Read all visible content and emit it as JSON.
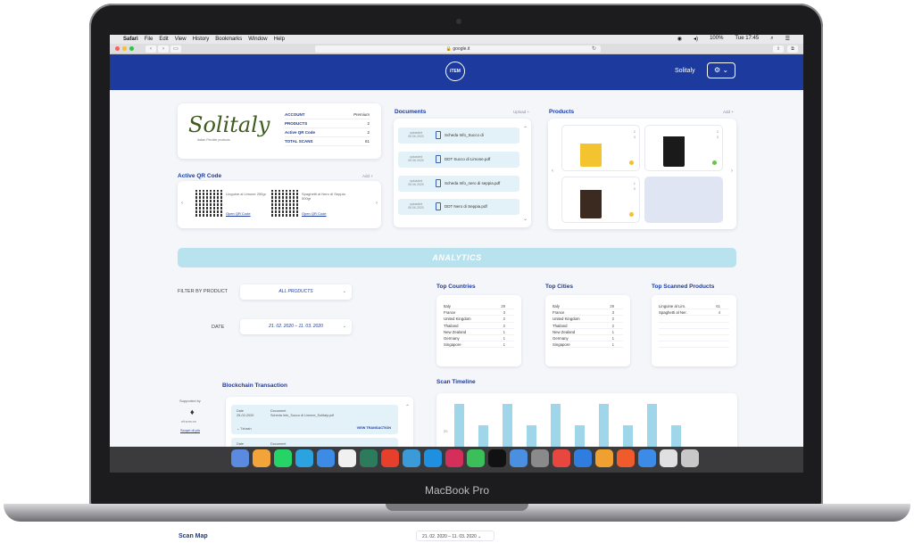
{
  "laptop": {
    "brand": "MacBook Pro"
  },
  "menubar": {
    "apple": "",
    "items": [
      "Safari",
      "File",
      "Edit",
      "View",
      "History",
      "Bookmarks",
      "Window",
      "Help"
    ],
    "battery": "100%",
    "clock": "Tue 17:45"
  },
  "safari": {
    "url": "google.it"
  },
  "app": {
    "account_name": "Solitaly",
    "logo_text": "iTEM"
  },
  "account": {
    "brand": "Solitaly",
    "tagline": "Italian Flexible products",
    "rows": [
      {
        "k": "ACCOUNT",
        "v": "Premium"
      },
      {
        "k": "PRODUCTS",
        "v": "2"
      },
      {
        "k": "Active QR Code",
        "v": "2"
      },
      {
        "k": "TOTAL SCANS",
        "v": "61"
      }
    ]
  },
  "active_qr": {
    "title": "Active QR Code",
    "add": "Add",
    "items": [
      {
        "name": "Linguine al Limone 250gr",
        "link": "Open QR Code"
      },
      {
        "name": "Spaghetti al Nero di Seppia 500gr",
        "link": "Open QR Code"
      }
    ]
  },
  "documents": {
    "title": "Documents",
    "upload": "Upload",
    "items": [
      {
        "date": "uploaded 05.06.2020",
        "name": "Scheda Info_Succo di"
      },
      {
        "date": "uploaded 05.06.2020",
        "name": "DDT Succo di Limone.pdf"
      },
      {
        "date": "uploaded 05.06.2020",
        "name": "Scheda Info_nero di seppia.pdf"
      },
      {
        "date": "uploaded 05.06.2020",
        "name": "DDT Nero di Seppia.pdf"
      }
    ]
  },
  "products": {
    "title": "Products",
    "add": "Add",
    "items": [
      {
        "s1": "2",
        "s2": "3",
        "dot": "#f2c12e"
      },
      {
        "s1": "2",
        "s2": "3",
        "dot": "#6cc24a"
      },
      {
        "s1": "1",
        "s2": "0",
        "dot": "#f2c12e"
      }
    ]
  },
  "analytics": {
    "title": "ANALYTICS"
  },
  "filters": {
    "product_label": "FILTER BY PRODUCT",
    "product_value": "ALL PRODUCTS",
    "date_label": "DATE",
    "date_value": "21. 02. 2020 – 11. 03. 2020"
  },
  "top_countries": {
    "title": "Top Countries",
    "rows": [
      {
        "name": "Italy",
        "n": "29"
      },
      {
        "name": "France",
        "n": "3"
      },
      {
        "name": "United Kingdom",
        "n": "2"
      },
      {
        "name": "Thailand",
        "n": "2"
      },
      {
        "name": "New Zealand",
        "n": "1"
      },
      {
        "name": "Germany",
        "n": "1"
      },
      {
        "name": "Singapore",
        "n": "1"
      }
    ]
  },
  "top_cities": {
    "title": "Top Cities",
    "rows": [
      {
        "name": "Italy",
        "n": "29"
      },
      {
        "name": "France",
        "n": "3"
      },
      {
        "name": "United Kingdom",
        "n": "2"
      },
      {
        "name": "Thailand",
        "n": "2"
      },
      {
        "name": "New Zealand",
        "n": "1"
      },
      {
        "name": "Germany",
        "n": "1"
      },
      {
        "name": "Singapore",
        "n": "1"
      }
    ]
  },
  "top_products": {
    "title": "Top Scanned Products",
    "rows": [
      {
        "name": "Linguine al Lim.",
        "n": "61"
      },
      {
        "name": "Spaghetti al Ner.",
        "n": "4"
      }
    ]
  },
  "blockchain": {
    "title": "Blockchain Transaction",
    "supported_by": "Supported by",
    "provider": "ethereum",
    "provider_link": "Scopri di più",
    "rows": [
      {
        "date_label": "Date",
        "date": "25-02-2020",
        "doc_label": "Document",
        "doc": "Scheda Info_Succo di Limone_Solitaly.pdf",
        "chain": "Txhash",
        "action": "VIEW TRANSACTION"
      },
      {
        "date_label": "Date",
        "doc_label": "Document"
      }
    ]
  },
  "scan_timeline": {
    "title": "Scan Timeline",
    "y_tick": "20",
    "bars": [
      16,
      8,
      16,
      8,
      16,
      8,
      16,
      8,
      16,
      8
    ]
  },
  "scan_map": {
    "title": "Scan Map",
    "date": "21. 02. 2020 – 11. 03. 2020"
  }
}
